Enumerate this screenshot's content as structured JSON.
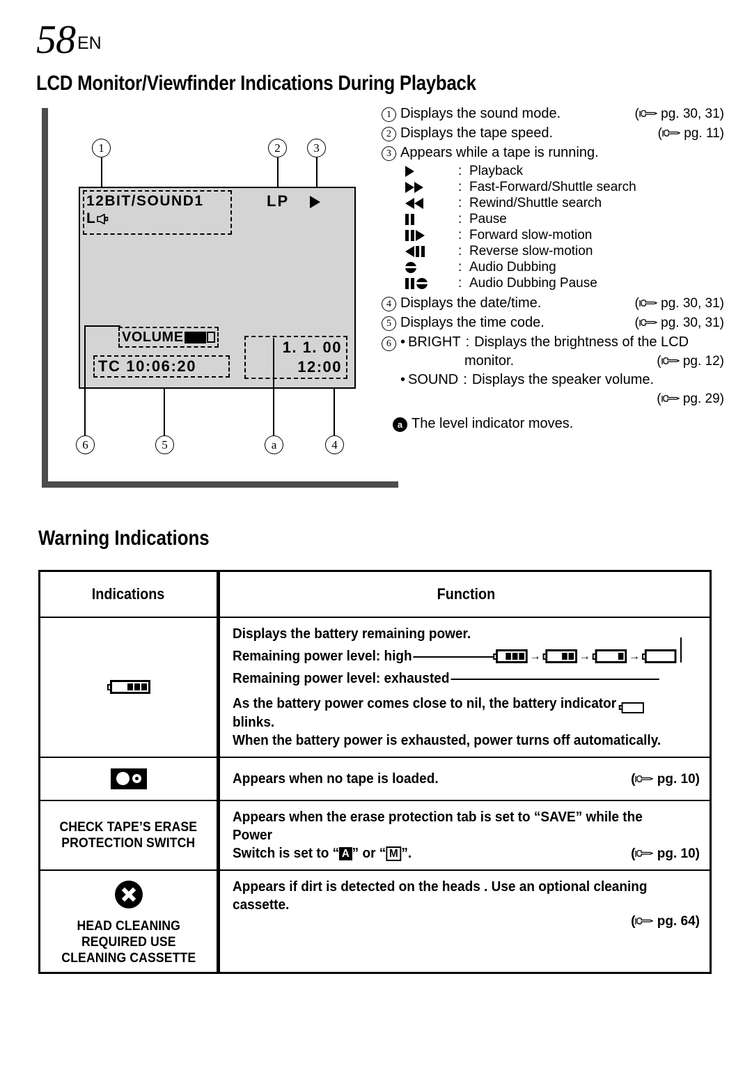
{
  "header": {
    "page_number": "58",
    "language": "EN",
    "section_title": "LCD Monitor/Viewfinder Indications During Playback"
  },
  "lcd_screen": {
    "sound_mode": "12BIT/SOUND1",
    "channel": "L",
    "speaker_icon": "speaker-icon",
    "tape_speed": "LP",
    "transport_icon": "play-triangle-icon",
    "volume_label": "VOLUME",
    "time_code": "TC  10:06:20",
    "date": "1.  1. 00",
    "time": "12:00",
    "callouts": [
      {
        "id": "1",
        "style": "outline"
      },
      {
        "id": "2",
        "style": "outline"
      },
      {
        "id": "3",
        "style": "outline"
      },
      {
        "id": "4",
        "style": "outline"
      },
      {
        "id": "5",
        "style": "outline"
      },
      {
        "id": "6",
        "style": "outline"
      },
      {
        "id": "a",
        "style": "outline"
      }
    ]
  },
  "legend": {
    "items": [
      {
        "num": "1",
        "text": "Displays the sound mode.",
        "ref": "pg. 30, 31"
      },
      {
        "num": "2",
        "text": "Displays the tape speed.",
        "ref": "pg. 11"
      },
      {
        "num": "3",
        "text": "Appears while a tape is running.",
        "ref": ""
      },
      {
        "num": "4",
        "text": "Displays the date/time.",
        "ref": "pg. 30, 31"
      },
      {
        "num": "5",
        "text": "Displays the time code.",
        "ref": "pg. 30, 31"
      }
    ],
    "transport_modes": [
      {
        "icon": "play-icon",
        "label": "Playback"
      },
      {
        "icon": "fast-forward-icon",
        "label": "Fast-Forward/Shuttle search"
      },
      {
        "icon": "rewind-icon",
        "label": "Rewind/Shuttle search"
      },
      {
        "icon": "pause-icon",
        "label": "Pause"
      },
      {
        "icon": "forward-slow-motion-icon",
        "label": "Forward slow-motion"
      },
      {
        "icon": "reverse-slow-motion-icon",
        "label": "Reverse slow-motion"
      },
      {
        "icon": "audio-dubbing-icon",
        "label": "Audio Dubbing"
      },
      {
        "icon": "audio-dubbing-pause-icon",
        "label": "Audio Dubbing Pause"
      }
    ],
    "item6": {
      "num": "6",
      "bright_key": "BRIGHT",
      "bright_desc_line1": "Displays the brightness of the LCD",
      "bright_desc_line2": "monitor.",
      "bright_ref": "pg. 12",
      "sound_key": "SOUND",
      "sound_desc": "Displays the speaker volume.",
      "sound_ref": "pg. 29"
    },
    "note_a": {
      "marker": "a",
      "text": "The level indicator moves."
    },
    "colon": ":",
    "bullet": "•"
  },
  "warning": {
    "title": "Warning Indications",
    "columns": {
      "indications": "Indications",
      "function": "Function"
    },
    "rows": [
      {
        "icon": "battery-full-icon",
        "caption": "",
        "intro": "Displays the battery remaining power.",
        "level_high": "Remaining power level: high",
        "level_exhausted": "Remaining power level: exhausted",
        "battery_steps": [
          3,
          2,
          1,
          0
        ],
        "arrow": "→",
        "note_line1_a": "As the battery power comes close to nil, the battery indicator",
        "note_line1_b": "blinks.",
        "note_line2": "When the battery power is exhausted, power turns off automatically.",
        "ref": ""
      },
      {
        "icon": "cassette-tape-icon",
        "caption": "",
        "text": "Appears when no tape is loaded.",
        "ref": "pg. 10"
      },
      {
        "icon": "",
        "caption": "CHECK TAPE’S ERASE\nPROTECTION SWITCH",
        "text_line1": "Appears when the erase protection tab is set to “SAVE” while the Power",
        "text_line2_a": "Switch is set to “",
        "key_auto": "A",
        "text_line2_b": "” or “",
        "key_manual": "M",
        "text_line2_c": "”.",
        "ref": "pg. 10"
      },
      {
        "icon": "x-circle-icon",
        "caption": "HEAD CLEANING\nREQUIRED USE\nCLEANING CASSETTE",
        "text": "Appears if dirt is detected on the heads . Use an optional cleaning cassette.",
        "ref": "pg. 64"
      }
    ]
  }
}
